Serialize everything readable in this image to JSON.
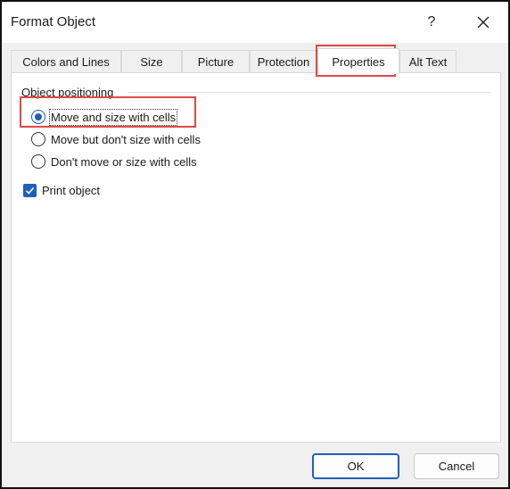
{
  "window": {
    "title": "Format Object",
    "help_glyph": "?",
    "close_icon": "close-icon"
  },
  "tabs": [
    {
      "label": "Colors and Lines",
      "active": false
    },
    {
      "label": "Size",
      "active": false
    },
    {
      "label": "Picture",
      "active": false
    },
    {
      "label": "Protection",
      "active": false
    },
    {
      "label": "Properties",
      "active": true
    },
    {
      "label": "Alt Text",
      "active": false
    }
  ],
  "positioning": {
    "group_label": "Object positioning",
    "options": [
      {
        "label": "Move and size with cells",
        "selected": true
      },
      {
        "label": "Move but don't size with cells",
        "selected": false
      },
      {
        "label": "Don't move or size with cells",
        "selected": false
      }
    ]
  },
  "print_object": {
    "label": "Print object",
    "checked": true
  },
  "buttons": {
    "ok": "OK",
    "cancel": "Cancel"
  },
  "colors": {
    "accent": "#1f5fbf",
    "annotation": "#e04848",
    "dialog_bg": "#f0f0f0"
  }
}
